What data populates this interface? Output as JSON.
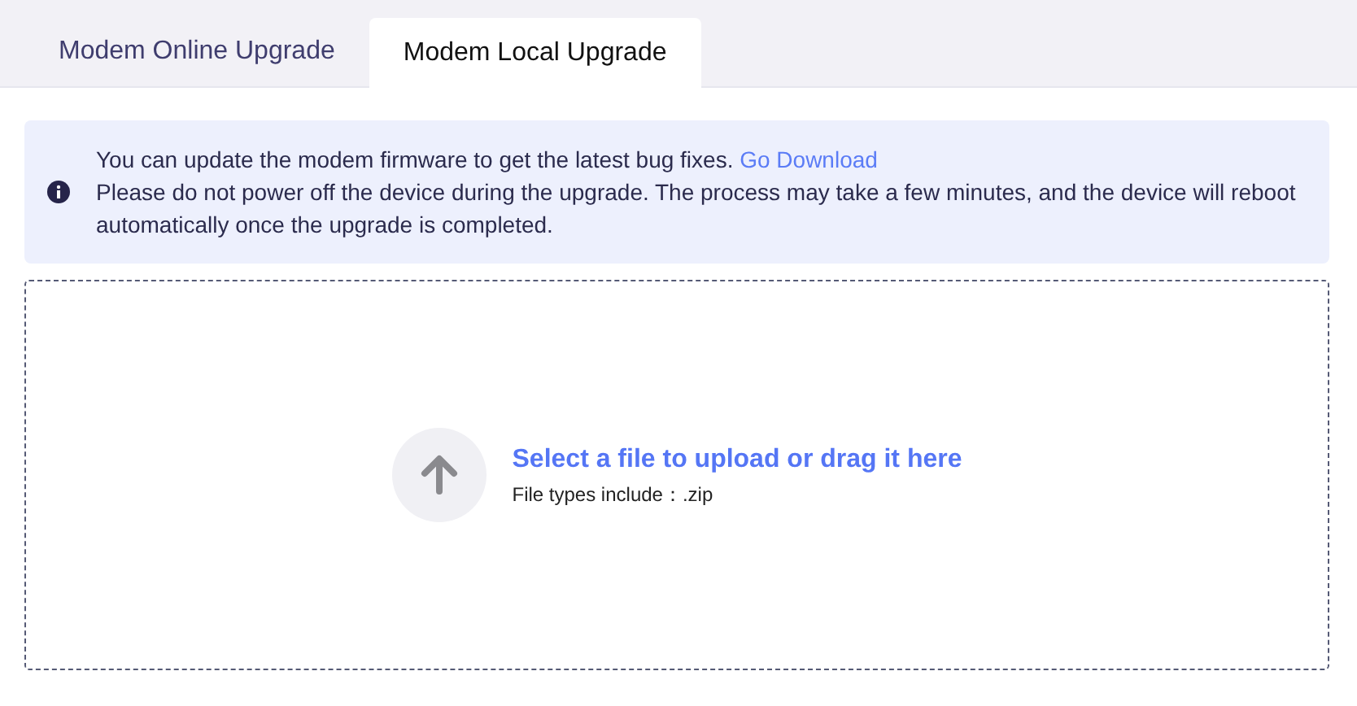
{
  "tabs": [
    {
      "label": "Modem Online Upgrade",
      "selected": false
    },
    {
      "label": "Modem Local Upgrade",
      "selected": true
    }
  ],
  "notice": {
    "lines": [
      {
        "text": "You can update the modem firmware to get the latest bug fixes.",
        "link": "Go Download"
      },
      {
        "text": "Please do not power off the device during the upgrade. The process may take a few minutes, and the device will reboot automatically once the upgrade is completed."
      }
    ]
  },
  "upload": {
    "title": "Select a file to upload or drag it here",
    "hint": "File types include：.zip"
  }
}
